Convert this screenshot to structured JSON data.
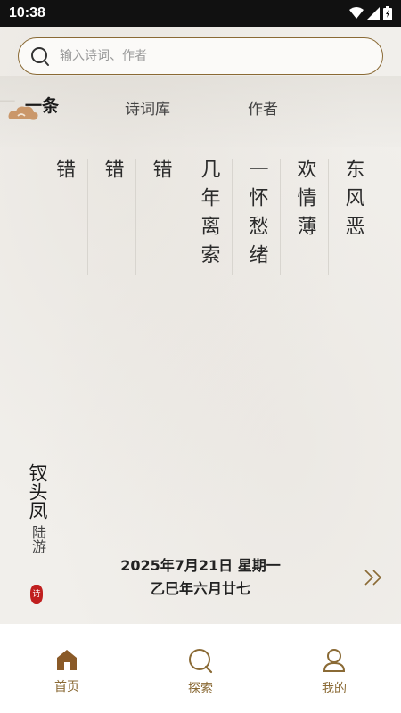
{
  "status_bar": {
    "time": "10:38"
  },
  "search": {
    "placeholder": "输入诗词、作者"
  },
  "tabs": [
    {
      "label": "一条",
      "active": true
    },
    {
      "label": "诗词库",
      "active": false
    },
    {
      "label": "作者",
      "active": false
    }
  ],
  "poem": {
    "columns": [
      "东风恶",
      "欢情薄",
      "一怀愁绪",
      "几年离索",
      "错",
      "错",
      "错"
    ],
    "title": "钗头凤",
    "author": "陆游",
    "seal": "诗"
  },
  "date": {
    "gregorian": "2025年7月21日 星期一",
    "lunar": "乙巳年六月廿七"
  },
  "bottom_nav": [
    {
      "label": "首页",
      "icon": "home-icon"
    },
    {
      "label": "探索",
      "icon": "explore-icon"
    },
    {
      "label": "我的",
      "icon": "profile-icon"
    }
  ],
  "colors": {
    "accent": "#8a6a35",
    "seal": "#c01f1f",
    "status_bar": "#111111"
  }
}
